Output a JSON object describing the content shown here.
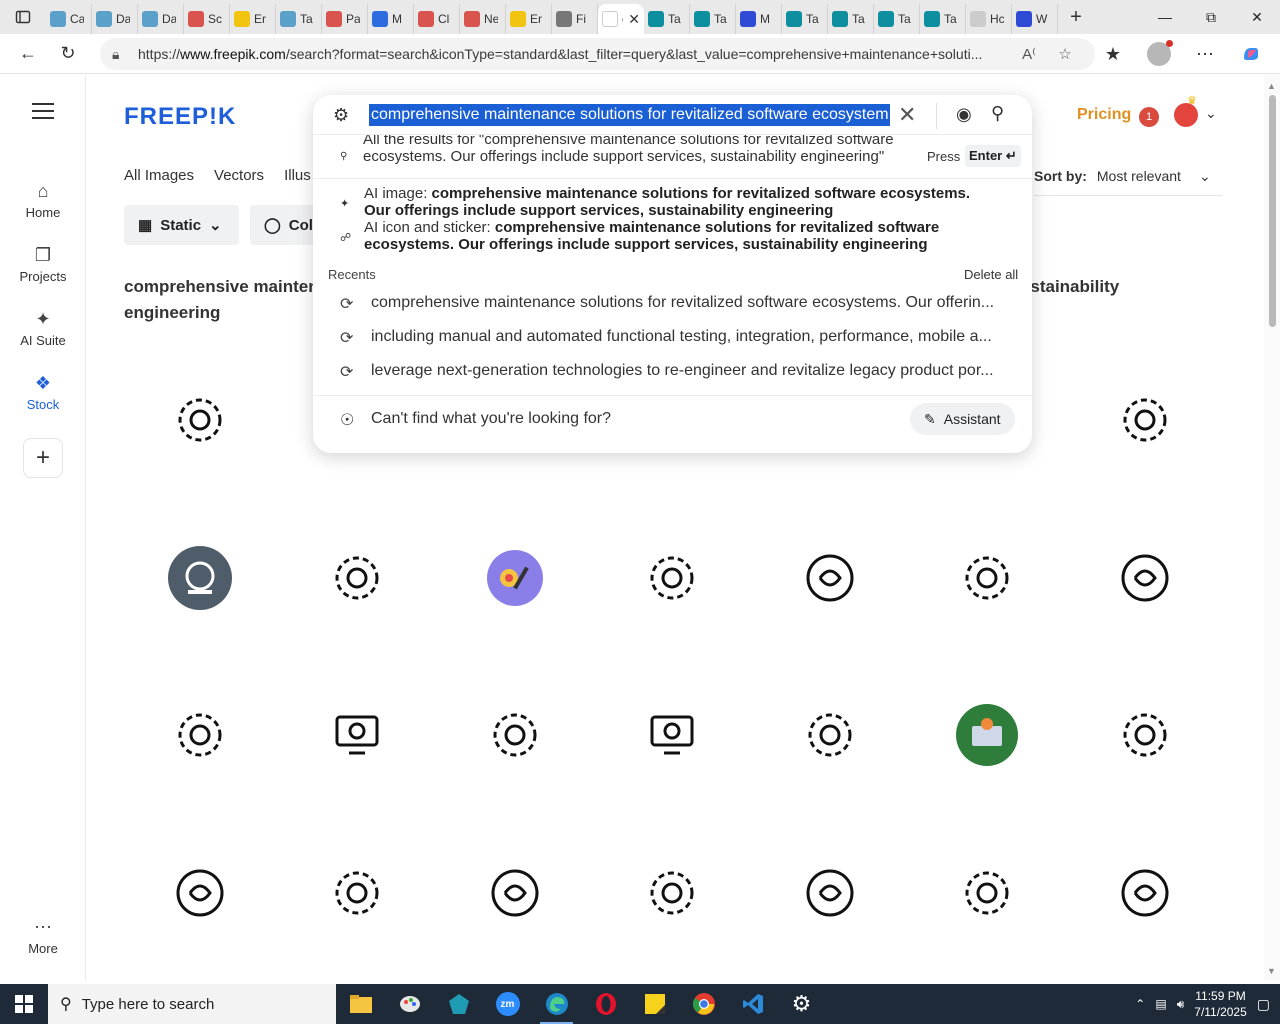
{
  "browser": {
    "tabs": [
      {
        "title": "Ca",
        "color": "#5aa0c8"
      },
      {
        "title": "Da",
        "color": "#5aa0c8"
      },
      {
        "title": "Da",
        "color": "#5aa0c8"
      },
      {
        "title": "Sc",
        "color": "#d9534f"
      },
      {
        "title": "Er",
        "color": "#f1c40f"
      },
      {
        "title": "Ta",
        "color": "#5aa0c8"
      },
      {
        "title": "Pa",
        "color": "#d9534f"
      },
      {
        "title": "M",
        "color": "#2d6cdf"
      },
      {
        "title": "Cl",
        "color": "#d9534f"
      },
      {
        "title": "Ne",
        "color": "#d9534f"
      },
      {
        "title": "Er",
        "color": "#f1c40f"
      },
      {
        "title": "Fi",
        "color": "#777777"
      },
      {
        "title": "cc",
        "color": "#ffffff",
        "active": true
      },
      {
        "title": "Ta",
        "color": "#0e8fa0"
      },
      {
        "title": "Ta",
        "color": "#0e8fa0"
      },
      {
        "title": "M",
        "color": "#2f4bd6"
      },
      {
        "title": "Ta",
        "color": "#0e8fa0"
      },
      {
        "title": "Ta",
        "color": "#0e8fa0"
      },
      {
        "title": "Ta",
        "color": "#0e8fa0"
      },
      {
        "title": "Ta",
        "color": "#0e8fa0"
      },
      {
        "title": "Hc",
        "color": "#cccccc"
      },
      {
        "title": "W",
        "color": "#2f4bd6"
      }
    ],
    "url_prefix": "https://",
    "url_domain": "www.freepik.com",
    "url_rest": "/search?format=search&iconType=standard&last_filter=query&last_value=comprehensive+maintenance+soluti..."
  },
  "nav": {
    "items": [
      {
        "label": "Home",
        "icon": "home-icon"
      },
      {
        "label": "Projects",
        "icon": "projects-icon"
      },
      {
        "label": "AI Suite",
        "icon": "ai-suite-icon"
      },
      {
        "label": "Stock",
        "icon": "stock-icon"
      }
    ],
    "more": "More"
  },
  "header": {
    "logo": "FREEP!K",
    "pricing": "Pricing",
    "notification_count": "1"
  },
  "type_tabs": [
    "All Images",
    "Vectors",
    "Illus"
  ],
  "filters": {
    "static": "Static",
    "color": "Col"
  },
  "sort": {
    "label": "Sort by:",
    "value": "Most relevant"
  },
  "heading": {
    "left_line1": "comprehensive maintena",
    "right_line1": "ustainability",
    "line2": "engineering"
  },
  "search": {
    "query": "comprehensive maintenance solutions for revitalized software ecosystem",
    "all_results": "All the results for \"comprehensive maintenance solutions for revitalized software ecosystems. Our offerings include support services, sustainability engineering\"",
    "press": "Press",
    "enter": "Enter ↵",
    "ai_image_prefix": "AI image: ",
    "ai_image_text": "comprehensive maintenance solutions for revitalized software ecosystems. Our offerings include support services, sustainability engineering",
    "ai_icon_prefix": "AI icon and sticker: ",
    "ai_icon_text": "comprehensive maintenance solutions for revitalized software ecosystems. Our offerings include support services, sustainability engineering",
    "recents_label": "Recents",
    "delete_all": "Delete all",
    "recents": [
      "comprehensive maintenance solutions for revitalized software ecosystems. Our offerin...",
      "including manual and automated functional testing, integration, performance, mobile a...",
      "leverage next-generation technologies to re-engineer and revitalize legacy product por..."
    ],
    "cant_find": "Can't find what you're looking for?",
    "assistant": "Assistant"
  },
  "taskbar": {
    "search_placeholder": "Type here to search",
    "time": "11:59 PM",
    "date": "7/11/2025"
  }
}
